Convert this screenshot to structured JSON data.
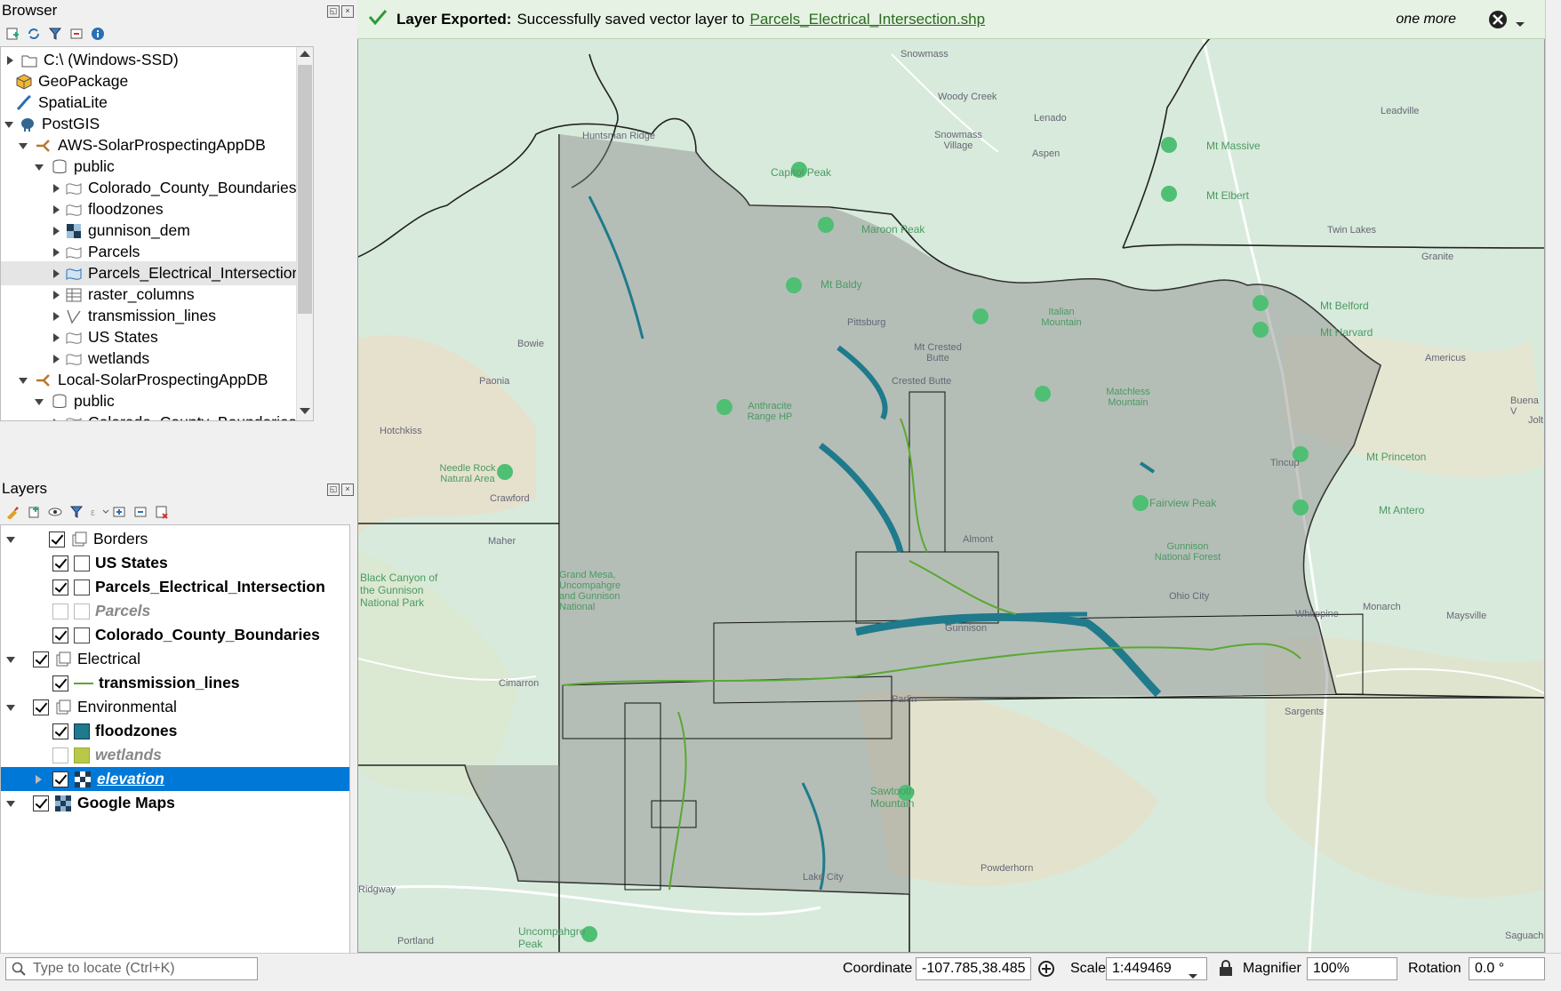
{
  "browser": {
    "title": "Browser",
    "items": [
      {
        "label": "C:\\ (Windows-SSD)",
        "icon": "folder-icon"
      },
      {
        "label": "GeoPackage",
        "icon": "geopackage-icon"
      },
      {
        "label": "SpatiaLite",
        "icon": "spatialite-icon"
      },
      {
        "label": "PostGIS",
        "icon": "postgis-elephant-icon"
      },
      {
        "label": "AWS-SolarProspectingAppDB",
        "icon": "connection-icon"
      },
      {
        "label": "public",
        "icon": "schema-icon"
      },
      {
        "label": "Colorado_County_Boundaries",
        "icon": "polygon-layer-icon"
      },
      {
        "label": "floodzones",
        "icon": "polygon-layer-icon"
      },
      {
        "label": "gunnison_dem",
        "icon": "raster-layer-icon"
      },
      {
        "label": "Parcels",
        "icon": "polygon-layer-icon"
      },
      {
        "label": "Parcels_Electrical_Intersection",
        "icon": "polygon-layer-icon"
      },
      {
        "label": "raster_columns",
        "icon": "table-icon"
      },
      {
        "label": "transmission_lines",
        "icon": "line-layer-icon"
      },
      {
        "label": "US States",
        "icon": "polygon-layer-icon"
      },
      {
        "label": "wetlands",
        "icon": "polygon-layer-icon"
      },
      {
        "label": "Local-SolarProspectingAppDB",
        "icon": "connection-icon"
      },
      {
        "label": "public",
        "icon": "schema-icon"
      },
      {
        "label": "Colorado_County_Boundaries",
        "icon": "polygon-layer-icon"
      }
    ]
  },
  "layers": {
    "title": "Layers",
    "items": [
      {
        "label": "Borders"
      },
      {
        "label": "US States"
      },
      {
        "label": "Parcels_Electrical_Intersection"
      },
      {
        "label": "Parcels"
      },
      {
        "label": "Colorado_County_Boundaries"
      },
      {
        "label": "Electrical"
      },
      {
        "label": "transmission_lines"
      },
      {
        "label": "Environmental"
      },
      {
        "label": "floodzones"
      },
      {
        "label": "wetlands"
      },
      {
        "label": "elevation"
      },
      {
        "label": "Google Maps"
      }
    ]
  },
  "message": {
    "bold": "Layer Exported:",
    "text": "Successfully saved vector layer to",
    "link": "Parcels_Electrical_Intersection.shp",
    "more": "one more"
  },
  "map_labels": [
    "Snowmass",
    "Woody Creek",
    "Lenado",
    "Snowmass Village",
    "Aspen",
    "Capitol Peak",
    "Maroon Peak",
    "Mt Massive",
    "Mt Elbert",
    "Twin Lakes",
    "Leadville",
    "Granite",
    "Mt Belford",
    "Mt Harvard",
    "Americus",
    "Buena V",
    "Mt Princeton",
    "Mt Antero",
    "Mt Baldy",
    "Pittsburg",
    "Mt Crested Butte",
    "Crested Butte",
    "Italian Mountain",
    "Anthracite Range HP",
    "Matchless Mountain",
    "Bowie",
    "Paonia",
    "Hotchkiss",
    "Needle Rock Natural Area",
    "Crawford",
    "Maher",
    "Black Canyon of the Gunnison National Park",
    "Grand Mesa, Uncompahgre and Gunnison National",
    "Cimarron",
    "Fairview Peak",
    "Gunnison National Forest",
    "Ohio City",
    "Tincup",
    "Whitepine",
    "Monarch",
    "Maysville",
    "Sargents",
    "Sawtooth Mountain",
    "Uncompahgre Peak",
    "Ridgway",
    "Portland",
    "Saguach",
    "Huntsman Ridge",
    "Lake City",
    "Powderhorn",
    "Parlin",
    "Gunnison",
    "Almont",
    "Jolt"
  ],
  "status": {
    "locate_placeholder": "Type to locate (Ctrl+K)",
    "coordinate_label": "Coordinate",
    "coordinate_value": "-107.785,38.485",
    "scale_label": "Scale",
    "scale_value": "1:449469",
    "magnifier_label": "Magnifier",
    "magnifier_value": "100%",
    "rotation_label": "Rotation",
    "rotation_value": "0.0 °"
  },
  "colors": {
    "floodzones": "#1f7a8c",
    "wetlands": "#b8c94a",
    "transmission": "#5aa832",
    "selection": "#0078d7"
  }
}
